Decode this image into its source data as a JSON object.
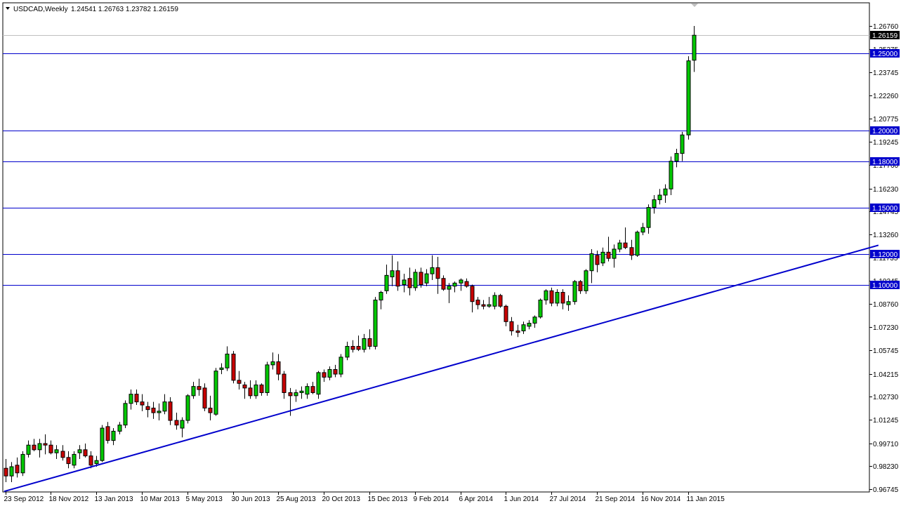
{
  "header": {
    "symbol_label": "USDCAD,Weekly",
    "ohlc_label": "1.24541 1.26763 1.23782 1.26159"
  },
  "chart_data": {
    "type": "candlestick",
    "symbol": "USDCAD",
    "timeframe": "Weekly",
    "last_bar": {
      "open": 1.24541,
      "high": 1.26763,
      "low": 1.23782,
      "close": 1.26159
    },
    "current_price_label": "1.26159",
    "ylim": [
      0.9645,
      1.2712
    ],
    "y_ticks": [
      "1.26760",
      "1.25275",
      "1.23745",
      "1.22260",
      "1.20775",
      "1.19245",
      "1.17760",
      "1.16230",
      "1.14745",
      "1.13260",
      "1.11735",
      "1.10245",
      "1.08760",
      "1.07230",
      "1.05745",
      "1.04215",
      "1.02730",
      "1.01245",
      "0.99710",
      "0.98230",
      "0.96745"
    ],
    "x_ticks": [
      {
        "index": 0,
        "label": "23 Sep 2012"
      },
      {
        "index": 8,
        "label": "18 Nov 2012"
      },
      {
        "index": 16,
        "label": "13 Jan 2013"
      },
      {
        "index": 24,
        "label": "10 Mar 2013"
      },
      {
        "index": 32,
        "label": "5 May 2013"
      },
      {
        "index": 40,
        "label": "30 Jun 2013"
      },
      {
        "index": 48,
        "label": "25 Aug 2013"
      },
      {
        "index": 56,
        "label": "20 Oct 2013"
      },
      {
        "index": 64,
        "label": "15 Dec 2013"
      },
      {
        "index": 72,
        "label": "9 Feb 2014"
      },
      {
        "index": 80,
        "label": "6 Apr 2014"
      },
      {
        "index": 88,
        "label": "1 Jun 2014"
      },
      {
        "index": 96,
        "label": "27 Jul 2014"
      },
      {
        "index": 104,
        "label": "21 Sep 2014"
      },
      {
        "index": 112,
        "label": "16 Nov 2014"
      },
      {
        "index": 120,
        "label": "11 Jan 2015"
      }
    ],
    "horizontal_levels": [
      {
        "price": 1.25,
        "label": "1.25000"
      },
      {
        "price": 1.2,
        "label": "1.20000"
      },
      {
        "price": 1.18,
        "label": "1.18000"
      },
      {
        "price": 1.15,
        "label": "1.15000"
      },
      {
        "price": 1.12,
        "label": "1.12000"
      },
      {
        "price": 1.1,
        "label": "1.10000"
      }
    ],
    "trendline": {
      "start": {
        "index": -0.2,
        "price": 0.966
      },
      "end": {
        "index": 153.5,
        "price": 1.1255
      }
    },
    "colors": {
      "bull": "#00c800",
      "bear": "#c80000",
      "wick": "#000000",
      "level_line": "#0000cc",
      "trendline": "#0000cc",
      "label_bg": "#0000cc",
      "price_label_bg": "#000000",
      "price_line": "#c0c0c0"
    },
    "candles": [
      {
        "o": 0.981,
        "h": 0.987,
        "l": 0.972,
        "c": 0.976
      },
      {
        "o": 0.976,
        "h": 0.985,
        "l": 0.972,
        "c": 0.982
      },
      {
        "o": 0.983,
        "h": 0.988,
        "l": 0.975,
        "c": 0.978
      },
      {
        "o": 0.978,
        "h": 0.992,
        "l": 0.976,
        "c": 0.99
      },
      {
        "o": 0.99,
        "h": 0.999,
        "l": 0.988,
        "c": 0.996
      },
      {
        "o": 0.996,
        "h": 1.0,
        "l": 0.992,
        "c": 0.993
      },
      {
        "o": 0.993,
        "h": 1.0,
        "l": 0.988,
        "c": 0.997
      },
      {
        "o": 0.997,
        "h": 1.003,
        "l": 0.99,
        "c": 0.996
      },
      {
        "o": 0.996,
        "h": 0.999,
        "l": 0.99,
        "c": 0.991
      },
      {
        "o": 0.991,
        "h": 0.996,
        "l": 0.987,
        "c": 0.993
      },
      {
        "o": 0.992,
        "h": 0.996,
        "l": 0.986,
        "c": 0.988
      },
      {
        "o": 0.988,
        "h": 0.992,
        "l": 0.981,
        "c": 0.984
      },
      {
        "o": 0.983,
        "h": 0.992,
        "l": 0.981,
        "c": 0.99
      },
      {
        "o": 0.991,
        "h": 0.996,
        "l": 0.987,
        "c": 0.993
      },
      {
        "o": 0.993,
        "h": 0.997,
        "l": 0.988,
        "c": 0.989
      },
      {
        "o": 0.989,
        "h": 0.992,
        "l": 0.981,
        "c": 0.983
      },
      {
        "o": 0.984,
        "h": 0.989,
        "l": 0.982,
        "c": 0.986
      },
      {
        "o": 0.986,
        "h": 1.009,
        "l": 0.985,
        "c": 1.007
      },
      {
        "o": 1.008,
        "h": 1.011,
        "l": 0.997,
        "c": 0.999
      },
      {
        "o": 0.999,
        "h": 1.007,
        "l": 0.996,
        "c": 1.005
      },
      {
        "o": 1.005,
        "h": 1.011,
        "l": 1.003,
        "c": 1.009
      },
      {
        "o": 1.009,
        "h": 1.025,
        "l": 1.007,
        "c": 1.023
      },
      {
        "o": 1.023,
        "h": 1.032,
        "l": 1.019,
        "c": 1.029
      },
      {
        "o": 1.029,
        "h": 1.032,
        "l": 1.022,
        "c": 1.024
      },
      {
        "o": 1.024,
        "h": 1.029,
        "l": 1.018,
        "c": 1.022
      },
      {
        "o": 1.021,
        "h": 1.024,
        "l": 1.014,
        "c": 1.019
      },
      {
        "o": 1.02,
        "h": 1.024,
        "l": 1.013,
        "c": 1.017
      },
      {
        "o": 1.017,
        "h": 1.023,
        "l": 1.012,
        "c": 1.018
      },
      {
        "o": 1.018,
        "h": 1.029,
        "l": 1.016,
        "c": 1.024
      },
      {
        "o": 1.024,
        "h": 1.027,
        "l": 1.009,
        "c": 1.012
      },
      {
        "o": 1.012,
        "h": 1.017,
        "l": 1.006,
        "c": 1.009
      },
      {
        "o": 1.007,
        "h": 1.014,
        "l": 1.001,
        "c": 1.012
      },
      {
        "o": 1.012,
        "h": 1.029,
        "l": 1.01,
        "c": 1.028
      },
      {
        "o": 1.028,
        "h": 1.037,
        "l": 1.026,
        "c": 1.034
      },
      {
        "o": 1.034,
        "h": 1.039,
        "l": 1.028,
        "c": 1.032
      },
      {
        "o": 1.033,
        "h": 1.036,
        "l": 1.018,
        "c": 1.02
      },
      {
        "o": 1.02,
        "h": 1.028,
        "l": 1.012,
        "c": 1.017
      },
      {
        "o": 1.016,
        "h": 1.046,
        "l": 1.015,
        "c": 1.044
      },
      {
        "o": 1.045,
        "h": 1.049,
        "l": 1.042,
        "c": 1.046
      },
      {
        "o": 1.046,
        "h": 1.06,
        "l": 1.044,
        "c": 1.055
      },
      {
        "o": 1.055,
        "h": 1.057,
        "l": 1.036,
        "c": 1.038
      },
      {
        "o": 1.038,
        "h": 1.044,
        "l": 1.032,
        "c": 1.036
      },
      {
        "o": 1.035,
        "h": 1.037,
        "l": 1.026,
        "c": 1.033
      },
      {
        "o": 1.033,
        "h": 1.038,
        "l": 1.026,
        "c": 1.028
      },
      {
        "o": 1.028,
        "h": 1.038,
        "l": 1.026,
        "c": 1.035
      },
      {
        "o": 1.035,
        "h": 1.036,
        "l": 1.028,
        "c": 1.03
      },
      {
        "o": 1.03,
        "h": 1.05,
        "l": 1.028,
        "c": 1.048
      },
      {
        "o": 1.048,
        "h": 1.056,
        "l": 1.045,
        "c": 1.05
      },
      {
        "o": 1.05,
        "h": 1.055,
        "l": 1.038,
        "c": 1.042
      },
      {
        "o": 1.042,
        "h": 1.044,
        "l": 1.026,
        "c": 1.03
      },
      {
        "o": 1.03,
        "h": 1.033,
        "l": 1.015,
        "c": 1.028
      },
      {
        "o": 1.028,
        "h": 1.032,
        "l": 1.024,
        "c": 1.03
      },
      {
        "o": 1.03,
        "h": 1.034,
        "l": 1.026,
        "c": 1.031
      },
      {
        "o": 1.029,
        "h": 1.036,
        "l": 1.026,
        "c": 1.034
      },
      {
        "o": 1.034,
        "h": 1.037,
        "l": 1.029,
        "c": 1.03
      },
      {
        "o": 1.029,
        "h": 1.044,
        "l": 1.026,
        "c": 1.043
      },
      {
        "o": 1.043,
        "h": 1.045,
        "l": 1.037,
        "c": 1.04
      },
      {
        "o": 1.04,
        "h": 1.047,
        "l": 1.038,
        "c": 1.045
      },
      {
        "o": 1.045,
        "h": 1.048,
        "l": 1.04,
        "c": 1.042
      },
      {
        "o": 1.042,
        "h": 1.055,
        "l": 1.04,
        "c": 1.053
      },
      {
        "o": 1.053,
        "h": 1.063,
        "l": 1.051,
        "c": 1.06
      },
      {
        "o": 1.06,
        "h": 1.064,
        "l": 1.056,
        "c": 1.058
      },
      {
        "o": 1.06,
        "h": 1.067,
        "l": 1.057,
        "c": 1.058
      },
      {
        "o": 1.058,
        "h": 1.068,
        "l": 1.056,
        "c": 1.065
      },
      {
        "o": 1.065,
        "h": 1.071,
        "l": 1.058,
        "c": 1.06
      },
      {
        "o": 1.06,
        "h": 1.092,
        "l": 1.058,
        "c": 1.09
      },
      {
        "o": 1.09,
        "h": 1.096,
        "l": 1.084,
        "c": 1.095
      },
      {
        "o": 1.096,
        "h": 1.113,
        "l": 1.094,
        "c": 1.106
      },
      {
        "o": 1.105,
        "h": 1.119,
        "l": 1.099,
        "c": 1.109
      },
      {
        "o": 1.109,
        "h": 1.115,
        "l": 1.096,
        "c": 1.099
      },
      {
        "o": 1.1,
        "h": 1.107,
        "l": 1.095,
        "c": 1.103
      },
      {
        "o": 1.104,
        "h": 1.111,
        "l": 1.093,
        "c": 1.098
      },
      {
        "o": 1.098,
        "h": 1.11,
        "l": 1.096,
        "c": 1.108
      },
      {
        "o": 1.108,
        "h": 1.111,
        "l": 1.098,
        "c": 1.1
      },
      {
        "o": 1.101,
        "h": 1.11,
        "l": 1.099,
        "c": 1.107
      },
      {
        "o": 1.107,
        "h": 1.119,
        "l": 1.103,
        "c": 1.111
      },
      {
        "o": 1.111,
        "h": 1.118,
        "l": 1.094,
        "c": 1.104
      },
      {
        "o": 1.104,
        "h": 1.106,
        "l": 1.096,
        "c": 1.097
      },
      {
        "o": 1.097,
        "h": 1.101,
        "l": 1.088,
        "c": 1.099
      },
      {
        "o": 1.099,
        "h": 1.102,
        "l": 1.095,
        "c": 1.101
      },
      {
        "o": 1.101,
        "h": 1.104,
        "l": 1.096,
        "c": 1.103
      },
      {
        "o": 1.102,
        "h": 1.104,
        "l": 1.098,
        "c": 1.099
      },
      {
        "o": 1.099,
        "h": 1.1,
        "l": 1.082,
        "c": 1.089
      },
      {
        "o": 1.09,
        "h": 1.092,
        "l": 1.084,
        "c": 1.087
      },
      {
        "o": 1.087,
        "h": 1.09,
        "l": 1.084,
        "c": 1.086
      },
      {
        "o": 1.086,
        "h": 1.092,
        "l": 1.085,
        "c": 1.087
      },
      {
        "o": 1.086,
        "h": 1.095,
        "l": 1.084,
        "c": 1.093
      },
      {
        "o": 1.093,
        "h": 1.094,
        "l": 1.085,
        "c": 1.086
      },
      {
        "o": 1.086,
        "h": 1.087,
        "l": 1.073,
        "c": 1.076
      },
      {
        "o": 1.076,
        "h": 1.079,
        "l": 1.067,
        "c": 1.07
      },
      {
        "o": 1.07,
        "h": 1.074,
        "l": 1.066,
        "c": 1.069
      },
      {
        "o": 1.07,
        "h": 1.076,
        "l": 1.068,
        "c": 1.074
      },
      {
        "o": 1.073,
        "h": 1.077,
        "l": 1.071,
        "c": 1.075
      },
      {
        "o": 1.075,
        "h": 1.08,
        "l": 1.072,
        "c": 1.079
      },
      {
        "o": 1.079,
        "h": 1.091,
        "l": 1.078,
        "c": 1.09
      },
      {
        "o": 1.09,
        "h": 1.097,
        "l": 1.087,
        "c": 1.096
      },
      {
        "o": 1.096,
        "h": 1.098,
        "l": 1.086,
        "c": 1.088
      },
      {
        "o": 1.088,
        "h": 1.097,
        "l": 1.086,
        "c": 1.095
      },
      {
        "o": 1.095,
        "h": 1.097,
        "l": 1.084,
        "c": 1.088
      },
      {
        "o": 1.087,
        "h": 1.093,
        "l": 1.083,
        "c": 1.089
      },
      {
        "o": 1.089,
        "h": 1.103,
        "l": 1.087,
        "c": 1.102
      },
      {
        "o": 1.102,
        "h": 1.103,
        "l": 1.094,
        "c": 1.096
      },
      {
        "o": 1.096,
        "h": 1.11,
        "l": 1.094,
        "c": 1.109
      },
      {
        "o": 1.109,
        "h": 1.123,
        "l": 1.101,
        "c": 1.12
      },
      {
        "o": 1.119,
        "h": 1.122,
        "l": 1.108,
        "c": 1.113
      },
      {
        "o": 1.114,
        "h": 1.124,
        "l": 1.112,
        "c": 1.121
      },
      {
        "o": 1.121,
        "h": 1.131,
        "l": 1.115,
        "c": 1.117
      },
      {
        "o": 1.117,
        "h": 1.126,
        "l": 1.111,
        "c": 1.123
      },
      {
        "o": 1.123,
        "h": 1.129,
        "l": 1.121,
        "c": 1.127
      },
      {
        "o": 1.127,
        "h": 1.137,
        "l": 1.123,
        "c": 1.124
      },
      {
        "o": 1.124,
        "h": 1.129,
        "l": 1.116,
        "c": 1.119
      },
      {
        "o": 1.119,
        "h": 1.135,
        "l": 1.118,
        "c": 1.134
      },
      {
        "o": 1.134,
        "h": 1.14,
        "l": 1.132,
        "c": 1.137
      },
      {
        "o": 1.137,
        "h": 1.152,
        "l": 1.133,
        "c": 1.15
      },
      {
        "o": 1.15,
        "h": 1.158,
        "l": 1.146,
        "c": 1.155
      },
      {
        "o": 1.155,
        "h": 1.162,
        "l": 1.152,
        "c": 1.158
      },
      {
        "o": 1.158,
        "h": 1.165,
        "l": 1.153,
        "c": 1.162
      },
      {
        "o": 1.162,
        "h": 1.183,
        "l": 1.158,
        "c": 1.18
      },
      {
        "o": 1.18,
        "h": 1.188,
        "l": 1.176,
        "c": 1.185
      },
      {
        "o": 1.185,
        "h": 1.199,
        "l": 1.18,
        "c": 1.197
      },
      {
        "o": 1.197,
        "h": 1.248,
        "l": 1.194,
        "c": 1.245
      },
      {
        "o": 1.2454,
        "h": 1.2676,
        "l": 1.2378,
        "c": 1.2616
      }
    ]
  }
}
